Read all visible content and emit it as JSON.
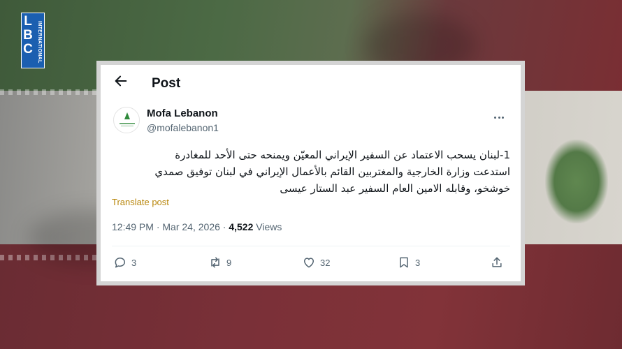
{
  "logo": {
    "letters": "L\nB\nC",
    "side_text": "INTERNATIONAL"
  },
  "header": {
    "title": "Post"
  },
  "author": {
    "name": "Mofa Lebanon",
    "handle": "@mofalebanon1"
  },
  "post": {
    "lines": [
      "1-لبنان يسحب الاعتماد عن السفير الإيراني المعيّن ويمنحه حتى الأحد للمغادرة",
      "استدعت وزارة الخارجية والمغتربين القائم بالأعمال الإيراني في لبنان توفيق صمدي",
      "خوشخو، وقابله الامين العام السفير عبد الستار عيسى"
    ],
    "translate_label": "Translate post",
    "time": "12:49 PM",
    "date": "Mar 24, 2026",
    "views_count": "4,522",
    "views_label": "Views"
  },
  "actions": {
    "replies": "3",
    "reposts": "9",
    "likes": "32",
    "bookmarks": "3"
  },
  "colors": {
    "link_gold": "#b8860b",
    "logo_blue": "#1b5fb0"
  }
}
